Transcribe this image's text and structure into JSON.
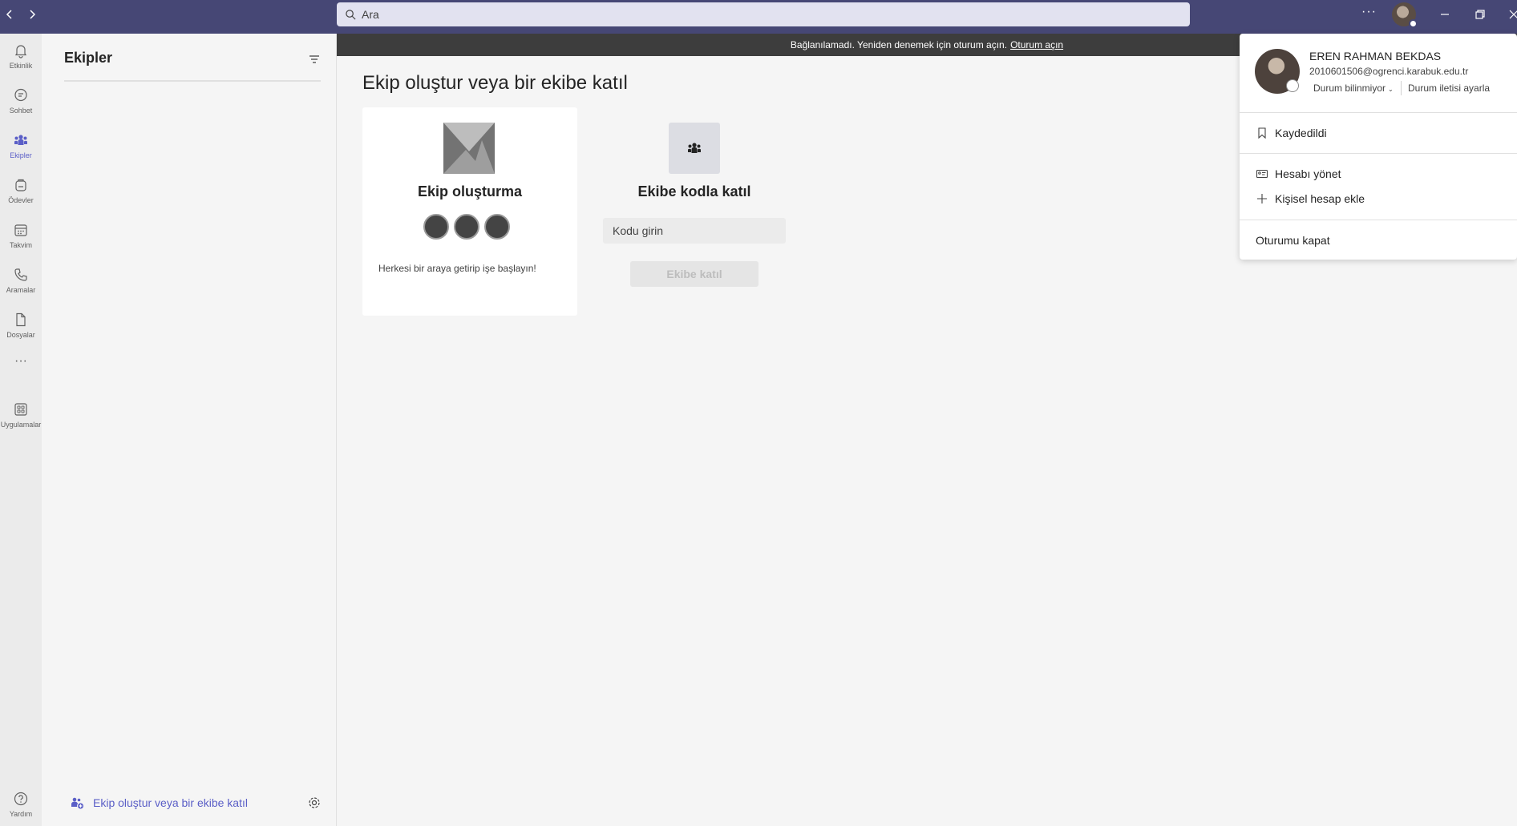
{
  "search": {
    "placeholder": "Ara"
  },
  "titlebar": {
    "more": "···"
  },
  "rail": {
    "activity": "Etkinlik",
    "chat": "Sohbet",
    "teams": "Ekipler",
    "assignments": "Ödevler",
    "calendar": "Takvim",
    "calls": "Aramalar",
    "files": "Dosyalar",
    "more": "···",
    "apps": "Uygulamalar",
    "help": "Yardım"
  },
  "panel": {
    "title": "Ekipler",
    "footer_link": "Ekip oluştur veya bir ekibe katıl"
  },
  "banner": {
    "message": "Bağlanılamadı. Yeniden denemek için oturum açın.",
    "link": "Oturum açın"
  },
  "main": {
    "title": "Ekip oluştur veya bir ekibe katıl",
    "create_card": {
      "title": "Ekip oluşturma",
      "description": "Herkesi bir araya getirip işe başlayın!"
    },
    "join_card": {
      "title": "Ekibe kodla katıl",
      "code_placeholder": "Kodu girin",
      "button": "Ekibe katıl"
    }
  },
  "profile": {
    "name": "EREN RAHMAN BEKDAS",
    "email": "2010601506@ogrenci.karabuk.edu.tr",
    "status": "Durum bilinmiyor",
    "status_message": "Durum iletisi ayarla",
    "saved": "Kaydedildi",
    "manage_account": "Hesabı yönet",
    "add_personal": "Kişisel hesap ekle",
    "sign_out": "Oturumu kapat"
  },
  "colors": {
    "titlebar": "#464775",
    "accent": "#5b5fc7",
    "banner": "#3d3d3d"
  }
}
